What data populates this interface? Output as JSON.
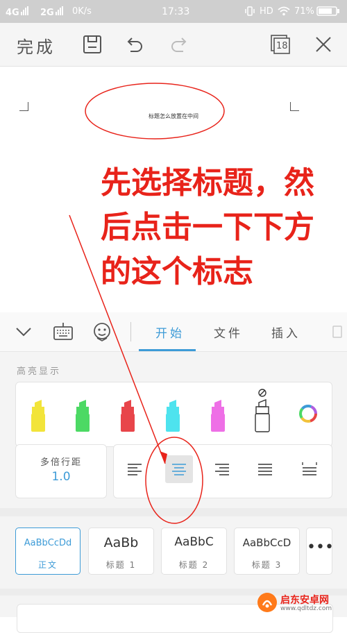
{
  "status_bar": {
    "network_1": "4G",
    "network_2": "2G",
    "speed": "0K/s",
    "time": "17:33",
    "hd": "HD",
    "battery": "71%"
  },
  "toolbar": {
    "done_label": "完成",
    "page_count": "18",
    "icons": [
      "save-icon",
      "undo-icon",
      "redo-icon",
      "pages-icon",
      "close-icon"
    ]
  },
  "document": {
    "title_text": "标题怎么放置在中间"
  },
  "annotation": {
    "lines": [
      "先选择标题，然",
      "后点击一下下方",
      "的这个标志"
    ],
    "color": "#e8231a"
  },
  "tabs": [
    {
      "label": "开始",
      "active": true
    },
    {
      "label": "文件",
      "active": false
    },
    {
      "label": "插入",
      "active": false
    }
  ],
  "highlight": {
    "section_label": "高亮显示",
    "colors": [
      "#f2e43a",
      "#4cd964",
      "#e8454a",
      "#4ee3ee",
      "#ee6fe6"
    ]
  },
  "paragraph": {
    "spacing_label": "多倍行距",
    "spacing_value": "1.0"
  },
  "styles": [
    {
      "preview": "AaBbCcDd",
      "name": "正文",
      "selected": true
    },
    {
      "preview": "AaBb",
      "name": "标题 1",
      "selected": false
    },
    {
      "preview": "AaBbC",
      "name": "标题 2",
      "selected": false
    },
    {
      "preview": "AaBbCcD",
      "name": "标题 3",
      "selected": false
    }
  ],
  "more_label": "•••",
  "watermark": {
    "text": "启东安卓网",
    "url": "www.qdltdz.com"
  },
  "accent_color": "#3d9bd7"
}
